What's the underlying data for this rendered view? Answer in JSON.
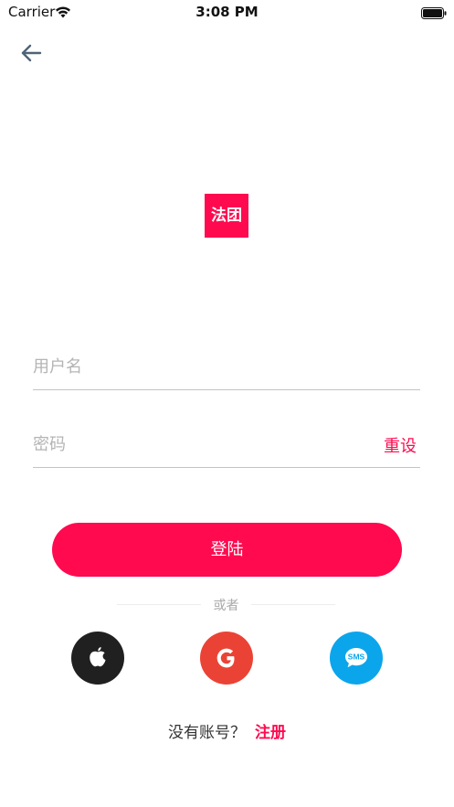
{
  "status_bar": {
    "carrier": "Carrier",
    "time": "3:08 PM"
  },
  "logo": {
    "text": "法团",
    "color": "#ff0a4f"
  },
  "form": {
    "username_placeholder": "用户名",
    "password_placeholder": "密码",
    "reset_label": "重设",
    "login_label": "登陆"
  },
  "divider": {
    "text": "或者"
  },
  "social": {
    "apple_icon": "apple-icon",
    "google_icon": "google-g-icon",
    "sms_icon": "sms-bubble-icon",
    "sms_text": "SMS",
    "apple_color": "#202020",
    "google_color": "#ea4335",
    "sms_color": "#0ba5ec"
  },
  "signup": {
    "question": "没有账号？",
    "link": "注册"
  },
  "colors": {
    "accent": "#ff0a4f"
  }
}
